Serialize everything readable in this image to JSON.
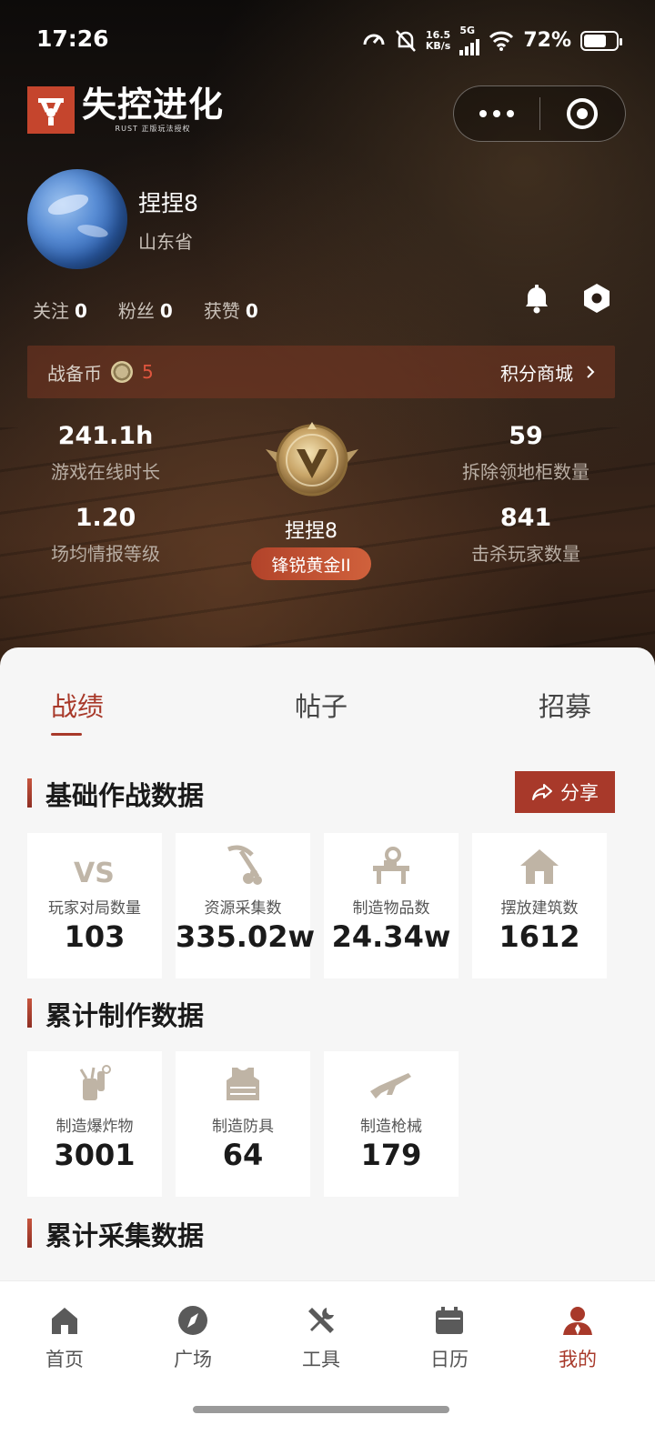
{
  "status": {
    "time": "17:26",
    "speed_value": "16.5",
    "speed_unit": "KB/s",
    "network": "5G",
    "battery": "72%",
    "battery_level": 0.72
  },
  "brand": {
    "name": "失控进化",
    "tagline": "RUST 正版玩法授权"
  },
  "profile": {
    "username": "捏捏8",
    "location": "山东省",
    "following_label": "关注",
    "following": "0",
    "fans_label": "粉丝",
    "fans": "0",
    "likes_label": "获赞",
    "likes": "0"
  },
  "coins": {
    "label": "战备币",
    "value": "5",
    "shop_label": "积分商城"
  },
  "stats": {
    "online_time": {
      "value": "241.1h",
      "label": "游戏在线时长"
    },
    "intel_level": {
      "value": "1.20",
      "label": "场均情报等级"
    },
    "cabinets_destroyed": {
      "value": "59",
      "label": "拆除领地柜数量"
    },
    "players_killed": {
      "value": "841",
      "label": "击杀玩家数量"
    }
  },
  "rank": {
    "player_name": "捏捏8",
    "tier": "锋锐黄金II"
  },
  "tabs": [
    {
      "label": "战绩"
    },
    {
      "label": "帖子"
    },
    {
      "label": "招募"
    }
  ],
  "sections": {
    "basic": {
      "title": "基础作战数据",
      "share_label": "分享",
      "cards": [
        {
          "icon": "vs-icon",
          "label": "玩家对局数量",
          "value": "103"
        },
        {
          "icon": "pickaxe-icon",
          "label": "资源采集数",
          "value": "335.02w"
        },
        {
          "icon": "workbench-icon",
          "label": "制造物品数",
          "value": "24.34w"
        },
        {
          "icon": "house-icon",
          "label": "摆放建筑数",
          "value": "1612"
        }
      ]
    },
    "crafting": {
      "title": "累计制作数据",
      "cards": [
        {
          "icon": "explosive-icon",
          "label": "制造爆炸物",
          "value": "3001"
        },
        {
          "icon": "armor-icon",
          "label": "制造防具",
          "value": "64"
        },
        {
          "icon": "rifle-icon",
          "label": "制造枪械",
          "value": "179"
        }
      ]
    },
    "gathering": {
      "title": "累计采集数据"
    }
  },
  "nav": [
    {
      "icon": "home-icon",
      "label": "首页"
    },
    {
      "icon": "compass-icon",
      "label": "广场"
    },
    {
      "icon": "tools-icon",
      "label": "工具"
    },
    {
      "icon": "calendar-icon",
      "label": "日历"
    },
    {
      "icon": "user-icon",
      "label": "我的"
    }
  ],
  "colors": {
    "accent": "#a8392a",
    "brand": "#c5452d"
  }
}
